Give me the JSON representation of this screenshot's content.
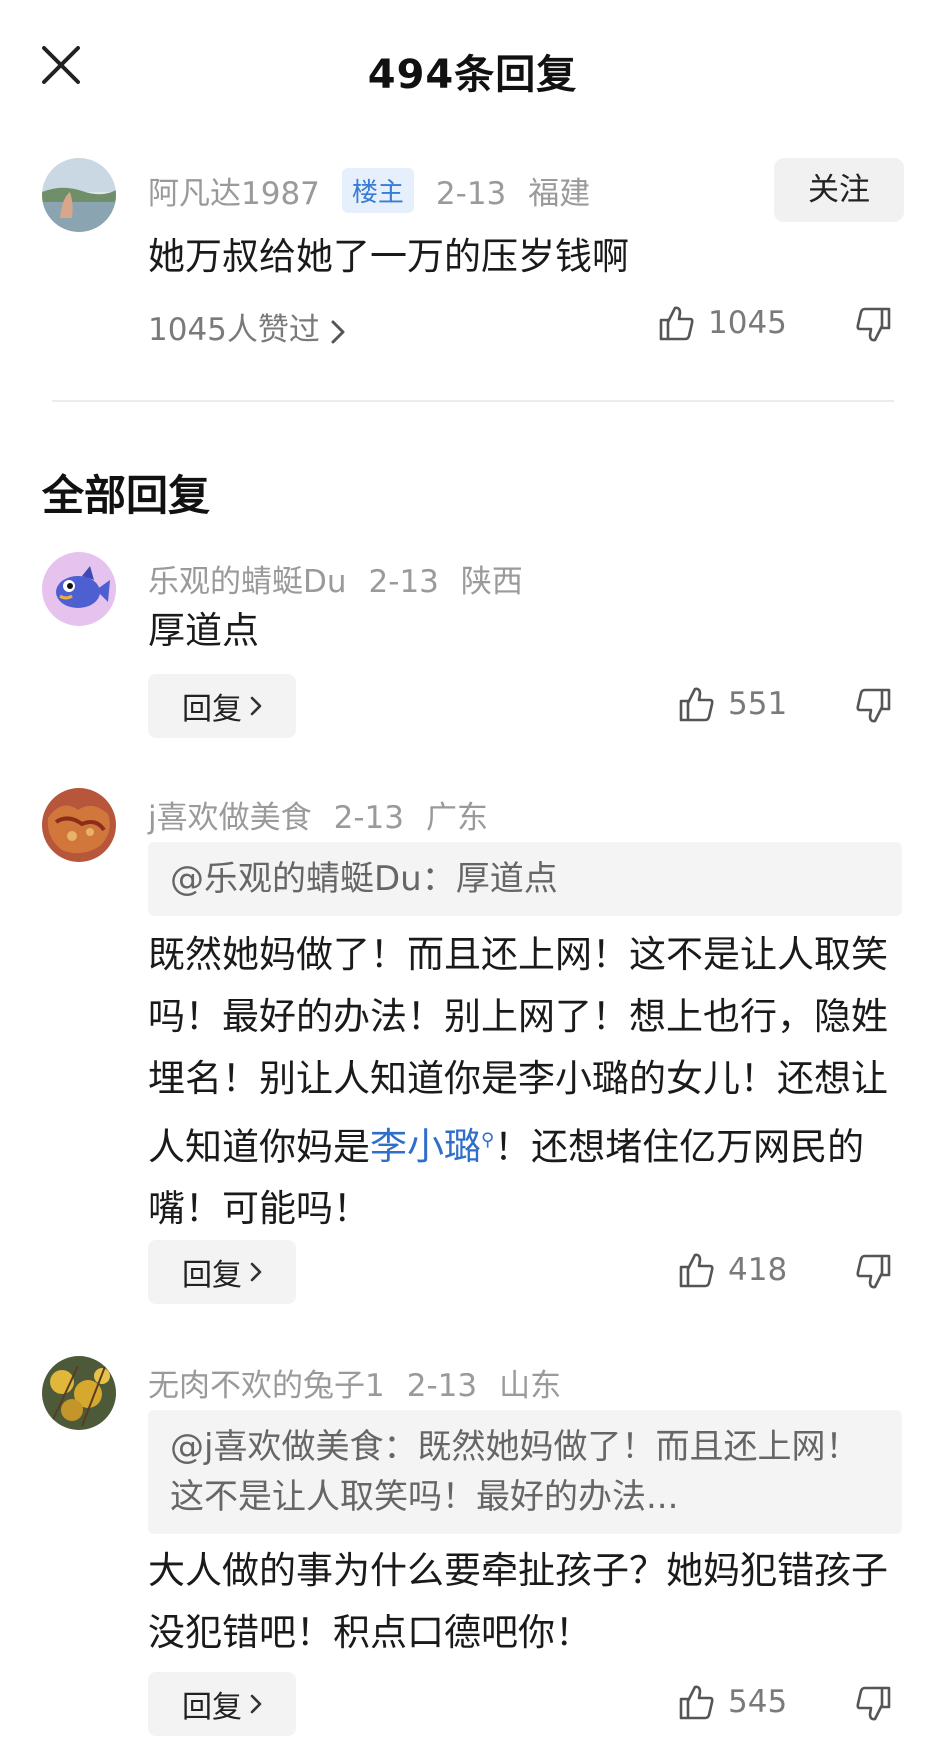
{
  "header": {
    "title": "494条回复"
  },
  "main_comment": {
    "user": "阿凡达1987",
    "badge": "楼主",
    "date": "2-13",
    "location": "福建",
    "follow_label": "关注",
    "text": "她万叔给她了一万的压岁钱啊",
    "likes_link": "1045人赞过",
    "like_count": "1045"
  },
  "section_title": "全部回复",
  "replies": [
    {
      "user": "乐观的蜻蜓Du",
      "date": "2-13",
      "location": "陕西",
      "text": "厚道点",
      "reply_label": "回复",
      "like_count": "551"
    },
    {
      "user": "j喜欢做美食",
      "date": "2-13",
      "location": "广东",
      "quote": "@乐观的蜻蜓Du：厚道点",
      "text_before": "既然她妈做了！而且还上网！这不是让人取笑吗！最好的办法！别上网了！想上也行，隐姓埋名！别让人知道你是李小璐的女儿！还想让人知道你妈是",
      "link": "李小璐",
      "text_after": "！还想堵住亿万网民的嘴！可能吗！",
      "reply_label": "回复",
      "like_count": "418"
    },
    {
      "user": "无肉不欢的兔子1",
      "date": "2-13",
      "location": "山东",
      "quote": "@j喜欢做美食：既然她妈做了！而且还上网！这不是让人取笑吗！最好的办法...",
      "text": "大人做的事为什么要牵扯孩子？她妈犯错孩子没犯错吧！积点口德吧你！",
      "reply_label": "回复",
      "like_count": "545"
    }
  ]
}
